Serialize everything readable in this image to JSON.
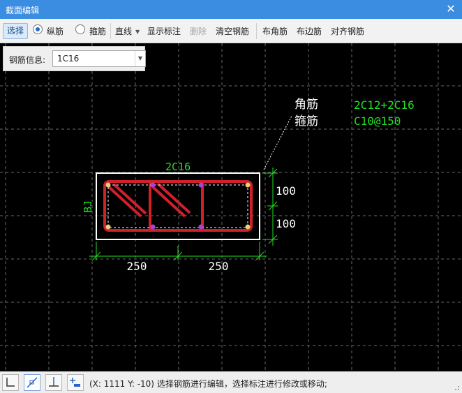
{
  "window": {
    "title": "截面编辑"
  },
  "toolbar": {
    "select": "选择",
    "longitudinal": "纵筋",
    "stirrup": "箍筋",
    "line_mode": "直线",
    "show_dims": "显示标注",
    "delete": "删除",
    "clear": "清空钢筋",
    "corner": "布角筋",
    "edge": "布边筋",
    "align": "对齐钢筋"
  },
  "rebar_info": {
    "label": "钢筋信息:",
    "value": "1C16"
  },
  "drawing": {
    "annotation_line1": "角筋",
    "annotation_line2": "箍筋",
    "spec_main": "2C12+2C16",
    "spec_stirrup": "C10@150",
    "top_label": "2C16",
    "side_label": "BJ",
    "dim_h1": "250",
    "dim_h2": "250",
    "dim_v1": "100",
    "dim_v2": "100"
  },
  "statusbar": {
    "coords": "(X: 1111 Y: -10)",
    "message": "选择钢筋进行编辑，选择标注进行修改或移动;"
  },
  "colors": {
    "title_bg": "#3a8de0",
    "canvas_bg": "#000000",
    "rebar": "#d0202a",
    "green": "#22e022",
    "grid": "#6a6a6a"
  }
}
